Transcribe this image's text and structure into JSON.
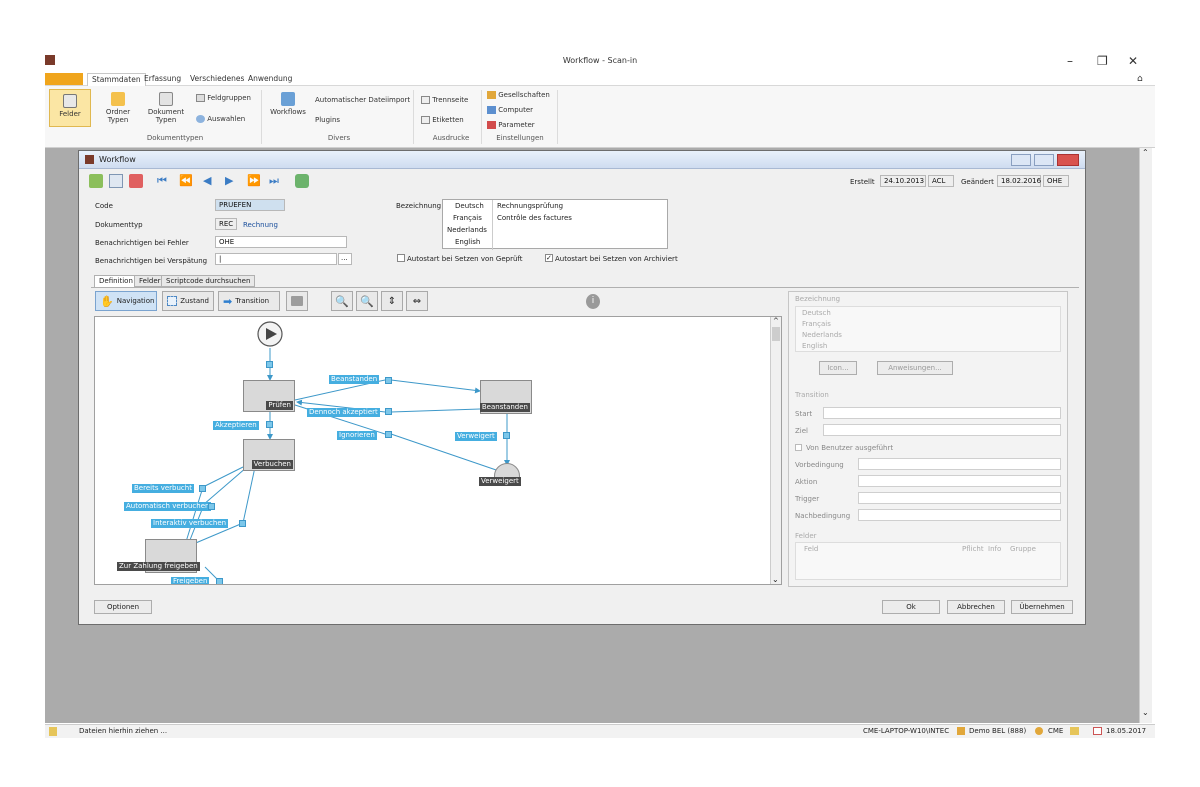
{
  "window": {
    "title": "Workflow - Scan-in",
    "minimize": "–",
    "restore": "❐",
    "close": "✕"
  },
  "menu": {
    "tabs": [
      "Stammdaten",
      "Erfassung",
      "Verschiedenes",
      "Anwendung"
    ]
  },
  "ribbon": {
    "dokumenttypen": {
      "label": "Dokumenttypen",
      "items": [
        "Felder",
        "Ordner Typen",
        "Dokument Typen",
        "Feldgruppen",
        "Auswahlen"
      ]
    },
    "divers": {
      "label": "Divers",
      "items": [
        "Workflows",
        "Automatischer Dateiimport",
        "Plugins"
      ]
    },
    "ausdrucke": {
      "label": "Ausdrucke",
      "items": [
        "Trennseite",
        "Etiketten"
      ]
    },
    "einstellungen": {
      "label": "Einstellungen",
      "items": [
        "Gesellschaften",
        "Computer",
        "Parameter"
      ]
    }
  },
  "workflow": {
    "title": "Workflow",
    "created_label": "Erstellt",
    "created_date": "24.10.2013",
    "created_user": "ACL",
    "changed_label": "Geändert",
    "changed_date": "18.02.2016",
    "changed_user": "OHE",
    "code_label": "Code",
    "code_value": "PRUEFEN",
    "doctype_label": "Dokumenttyp",
    "doctype_code": "REC",
    "doctype_name": "Rechnung",
    "notify_error_label": "Benachrichtigen bei Fehler",
    "notify_error_value": "OHE",
    "notify_delay_label": "Benachrichtigen bei Verspätung",
    "notify_delay_value": "|",
    "bezeichnung_label": "Bezeichnung",
    "languages": [
      {
        "lang": "Deutsch",
        "value": "Rechnungsprüfung"
      },
      {
        "lang": "Français",
        "value": "Contrôle des factures"
      },
      {
        "lang": "Nederlands",
        "value": ""
      },
      {
        "lang": "English",
        "value": ""
      }
    ],
    "autostart_checked": "Autostart bei Setzen von Geprüft",
    "autostart_archived": "Autostart bei Setzen von Archiviert",
    "tabs": [
      "Definition",
      "Felder",
      "Scriptcode durchsuchen"
    ],
    "toolbar": {
      "navigation": "Navigation",
      "zustand": "Zustand",
      "transition": "Transition"
    },
    "diagram": {
      "nodes": [
        "Prüfen",
        "Beanstanden",
        "Verbuchen",
        "Verweigert",
        "Zur Zahlung freigeben"
      ],
      "transitions": [
        "Beanstanden",
        "Dennoch akzeptiert",
        "Ignorieren",
        "Verweigert",
        "Akzeptieren",
        "Bereits verbucht",
        "Automatisch verbuchen",
        "Interaktiv verbuchen",
        "Freigeben"
      ]
    },
    "props": {
      "bezeichnung": "Bezeichnung",
      "languages": [
        "Deutsch",
        "Français",
        "Nederlands",
        "English"
      ],
      "icon_button": "Icon...",
      "anweisungen_button": "Anweisungen...",
      "transition": "Transition",
      "start": "Start",
      "ziel": "Ziel",
      "von_benutzer": "Von Benutzer ausgeführt",
      "vorbedingung": "Vorbedingung",
      "aktion": "Aktion",
      "trigger": "Trigger",
      "nachbedingung": "Nachbedingung",
      "felder": "Felder",
      "felder_cols": [
        "Feld",
        "Pflicht",
        "Info",
        "Gruppe"
      ]
    },
    "buttons": {
      "optionen": "Optionen",
      "ok": "Ok",
      "abbrechen": "Abbrechen",
      "uebernehmen": "Übernehmen"
    }
  },
  "statusbar": {
    "hint": "Dateien hierhin ziehen ...",
    "machine": "CME-LAPTOP-W10\\INTEC",
    "company": "Demo BEL (888)",
    "user": "CME",
    "date": "18.05.2017"
  },
  "colors": {
    "accent_orange": "#f0a51c",
    "transition_blue": "#45aee0",
    "node_gray": "#d9d9d9"
  }
}
